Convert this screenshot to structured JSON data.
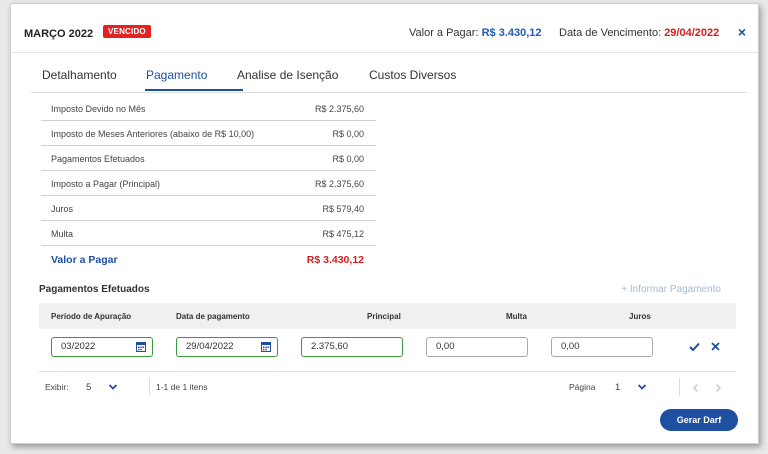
{
  "header": {
    "period": "MARÇO 2022",
    "status_badge": "VENCIDO",
    "valor_label": "Valor a Pagar:",
    "valor_value": "R$ 3.430,12",
    "venc_label": "Data de Vencimento:",
    "venc_value": "29/04/2022",
    "close_glyph": "×"
  },
  "tabs": [
    {
      "label": "Detalhamento",
      "active": false
    },
    {
      "label": "Pagamento",
      "active": true
    },
    {
      "label": "Analise de Isenção",
      "active": false
    },
    {
      "label": "Custos Diversos",
      "active": false
    }
  ],
  "summary": [
    {
      "label": "Imposto Devido no Mês",
      "value": "R$ 2.375,60"
    },
    {
      "label": "Imposto de Meses Anteriores (abaixo de R$ 10,00)",
      "value": "R$ 0,00"
    },
    {
      "label": "Pagamentos Efetuados",
      "value": "R$ 0,00"
    },
    {
      "label": "Imposto a Pagar (Principal)",
      "value": "R$ 2.375,60"
    },
    {
      "label": "Juros",
      "value": "R$ 579,40"
    },
    {
      "label": "Multa",
      "value": "R$ 475,12"
    },
    {
      "label": "Valor a Pagar",
      "value": "R$ 3.430,12"
    }
  ],
  "payments": {
    "title": "Pagamentos Efetuados",
    "add_label": "+ Informar Pagamento",
    "columns": [
      "Período de Apuração",
      "Data de pagamento",
      "Principal",
      "Multa",
      "Juros"
    ],
    "row": {
      "periodo": "03/2022",
      "data_pagamento": "29/04/2022",
      "principal": "2.375,60",
      "multa": "0,00",
      "juros": "0,00"
    },
    "pager": {
      "exibir_label": "Exibir:",
      "page_size": "5",
      "range_text": "1-1 de 1 itens",
      "pagina_label": "Página",
      "page": "1"
    }
  },
  "actions": {
    "gerar_darf": "Gerar Darf"
  },
  "colors": {
    "accent": "#1f4fa0",
    "danger": "#d71e1e",
    "success_border": "#3a9b3a"
  }
}
